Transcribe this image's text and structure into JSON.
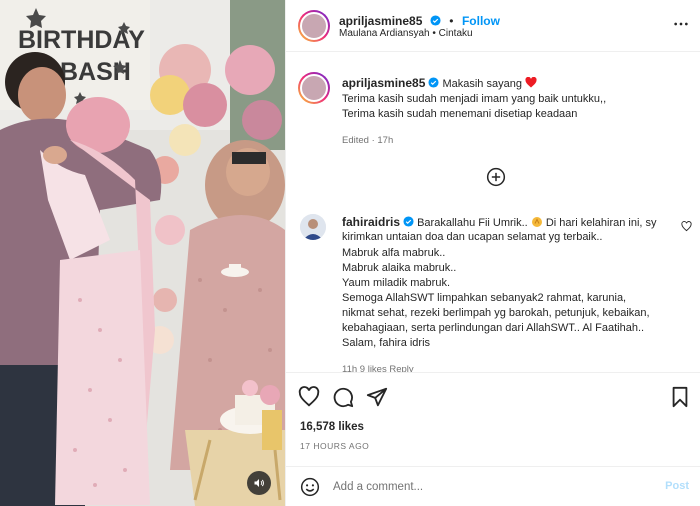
{
  "media": {
    "banner_line1": "BIRTHDAY",
    "banner_line2": "BASH",
    "sound_icon": "speaker-icon"
  },
  "header": {
    "username": "apriljasmine85",
    "follow_label": "Follow",
    "separator": "•",
    "audio_info": "Maulana Ardiansyah • Cintaku",
    "more_icon": "more-horizontal-icon"
  },
  "caption": {
    "username": "apriljasmine85",
    "line1": "Makasih sayang",
    "line2": "Terima kasih sudah menjadi imam yang baik untukku,,",
    "line3": "Terima kasih sudah menemani disetiap keadaan",
    "edited": "Edited · 17h"
  },
  "comment": {
    "username": "fahiraidris",
    "line1": "Barakallahu Fii Umrik..",
    "line1b": "Di hari kelahiran ini, sy",
    "line2": "kirimkan untaian doa dan ucapan selamat yg terbaik..",
    "line3": "Mabruk alfa mabruk..",
    "line4": "Mabruk alaika mabruk..",
    "line5": "Yaum miladik mabruk.",
    "line6": "Semoga AllahSWT limpahkan sebanyak2 rahmat, karunia,",
    "line7": "nikmat sehat, rezeki berlimpah yg barokah, petunjuk, kebaikan,",
    "line8": "kebahagiaan, serta perlindungan dari AllahSWT.. Al Faatihah..",
    "line9": "Salam, fahira idris",
    "meta_partial": "11h   9 likes   Reply"
  },
  "actions": {
    "likes": "16,578 likes",
    "time_ago": "17 HOURS AGO"
  },
  "add_comment": {
    "placeholder": "Add a comment...",
    "post_label": "Post"
  },
  "colors": {
    "accent": "#0095f6",
    "verified": "#0095f6",
    "post_disabled": "#b2dffc",
    "heart_emoji": "#ed1c24"
  }
}
